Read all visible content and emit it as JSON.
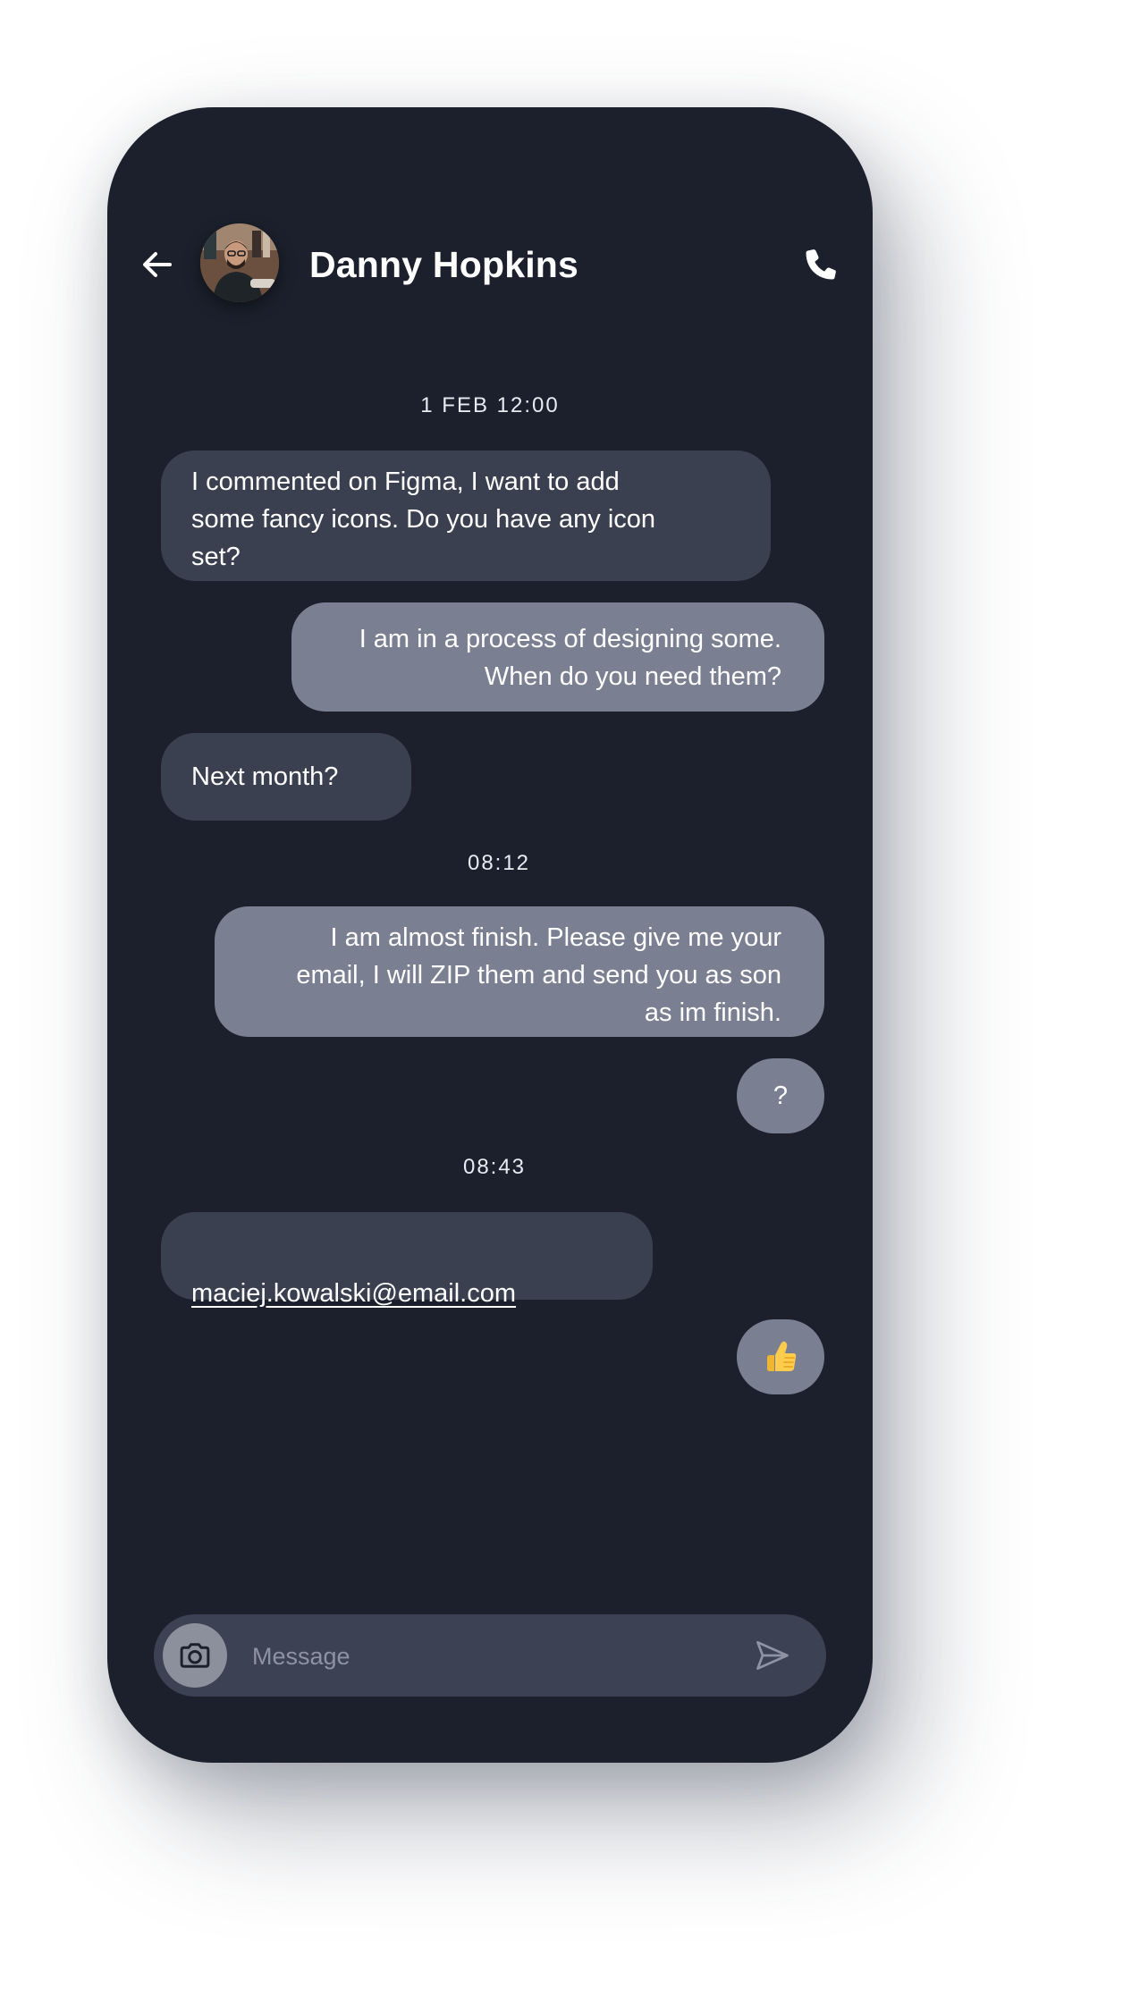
{
  "header": {
    "contact_name": "Danny Hopkins",
    "back_icon": "arrow-left-icon",
    "call_icon": "phone-icon",
    "avatar": "contact-avatar-photo"
  },
  "timestamps": [
    "1 FEB 12:00",
    "08:12",
    "08:43"
  ],
  "messages": [
    {
      "direction": "incoming",
      "text": "I commented on Figma, I want to add\nsome fancy icons. Do you have any icon\nset?"
    },
    {
      "direction": "outgoing",
      "text": "I am in a process of designing some.\nWhen do you need them?"
    },
    {
      "direction": "incoming",
      "text": "Next month?"
    },
    {
      "direction": "outgoing",
      "text": "I am almost finish. Please give me your\nemail, I will ZIP them and send you as son\nas im finish."
    },
    {
      "direction": "outgoing",
      "text": "?"
    },
    {
      "direction": "incoming",
      "text": "maciej.kowalski@email.com",
      "is_link": true
    },
    {
      "direction": "outgoing",
      "text": "👍",
      "is_emoji": true,
      "emoji": "thumbs-up"
    }
  ],
  "composer": {
    "placeholder": "Message",
    "value": "",
    "camera_icon": "camera-icon",
    "send_icon": "send-icon"
  },
  "colors": {
    "background": "#1b202c",
    "incoming_bubble": "#3b4050",
    "outgoing_bubble": "#7a7f92",
    "composer": "#3c4153",
    "text": "#ffffff",
    "placeholder": "#8e93a3"
  }
}
